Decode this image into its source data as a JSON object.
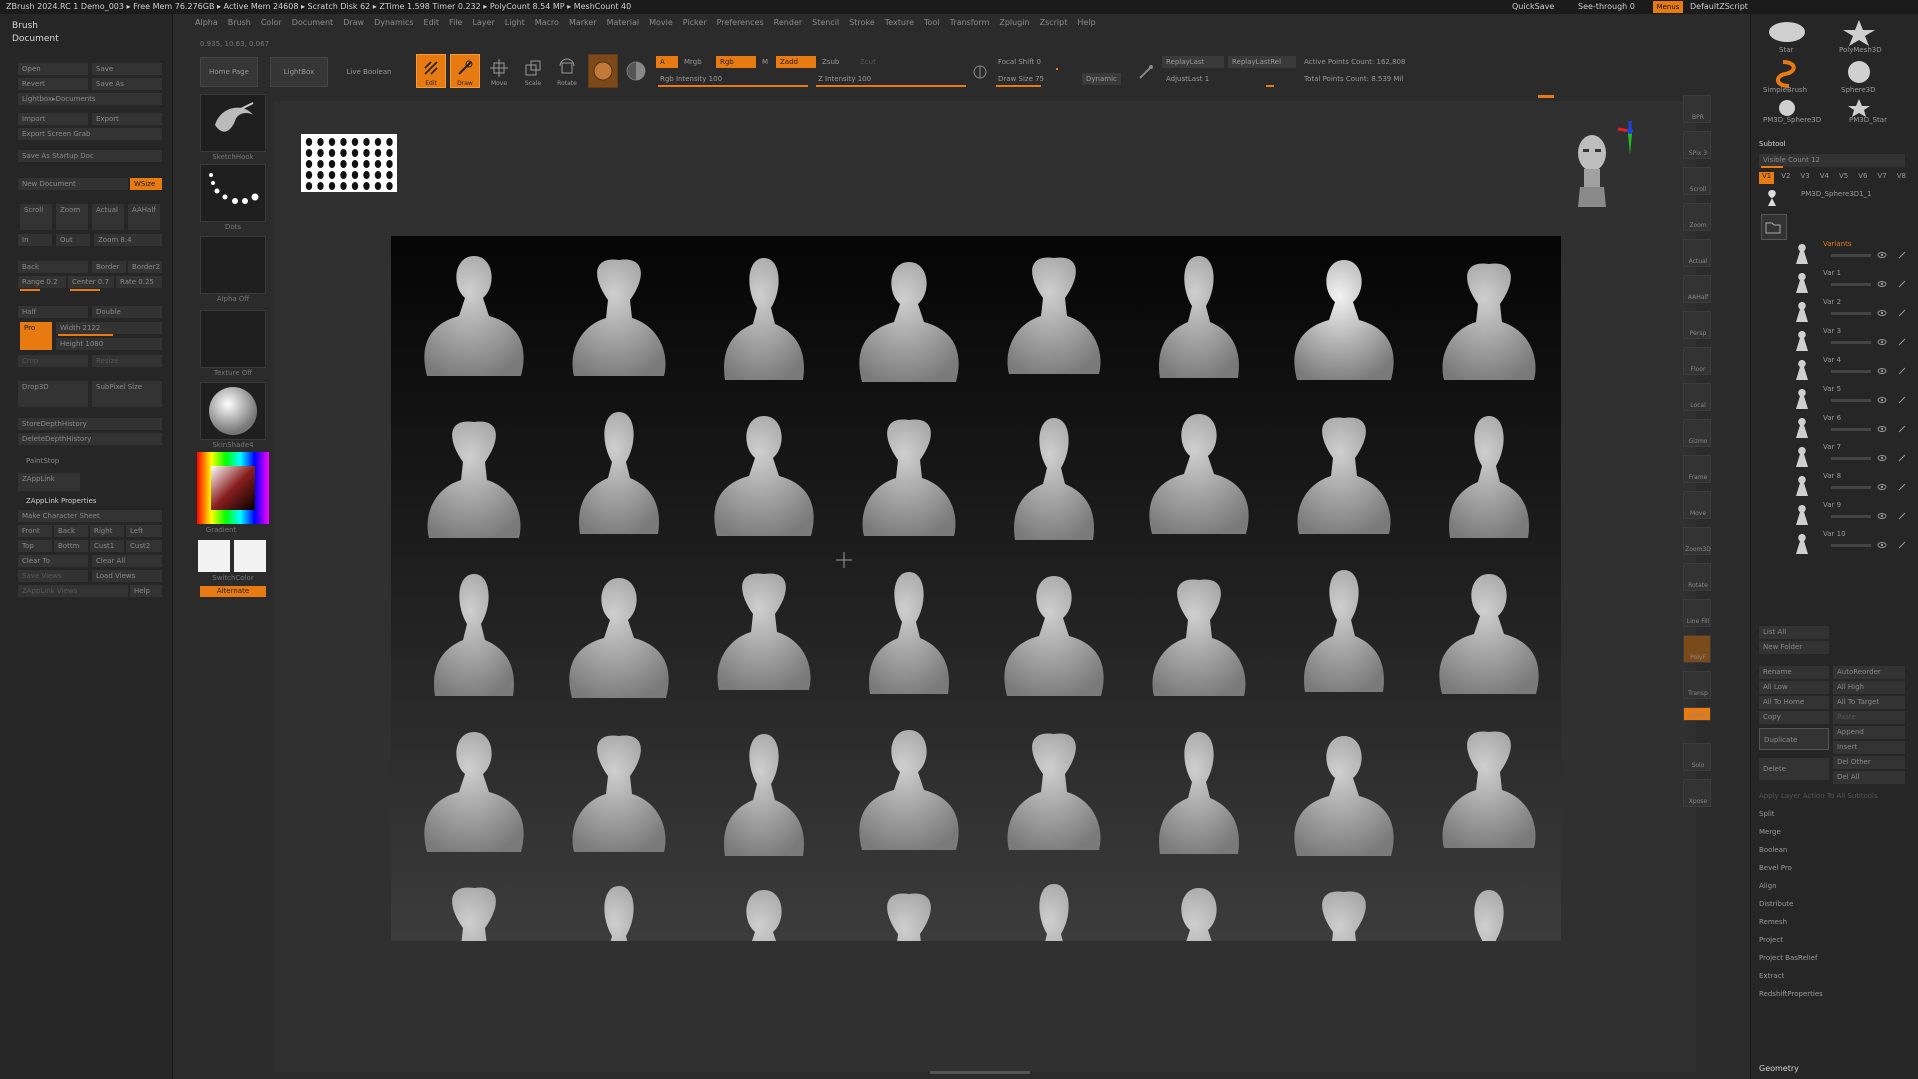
{
  "titlebar": {
    "title": "ZBrush 2024.RC 1   Demo_003   ▸ Free Mem 76.276GB ▸ Active Mem 24608 ▸ Scratch Disk 62 ▸ ZTime 1.598 Timer 0.232 ▸ PolyCount 8.54 MP ▸ MeshCount 40",
    "quicksave": "QuickSave",
    "seethrough": "See-through  0",
    "menus": "Menus",
    "defzscript": "DefaultZScript"
  },
  "menubar": [
    "Alpha",
    "Brush",
    "Color",
    "Document",
    "Draw",
    "Dynamics",
    "Edit",
    "File",
    "Layer",
    "Light",
    "Macro",
    "Marker",
    "Material",
    "Movie",
    "Picker",
    "Preferences",
    "Render",
    "Stencil",
    "Stroke",
    "Texture",
    "Tool",
    "Transform",
    "Zplugin",
    "Zscript",
    "Help"
  ],
  "coords": "0.935, 10.63, 0.067",
  "leftpanel": {
    "brush": "Brush",
    "document": "Document",
    "open": "Open",
    "save": "Save",
    "revert": "Revert",
    "save_as": "Save As",
    "lightbox_documents": "Lightbox▸Documents",
    "import": "Import",
    "export": "Export",
    "export_screen_grab": "Export Screen Grab",
    "save_as_startup": "Save As Startup Doc",
    "new_document": "New Document",
    "wsize": "WSize",
    "scroll": "Scroll",
    "zoom": "Zoom",
    "actual": "Actual",
    "aahalf": "AAHalf",
    "in": "In",
    "out": "Out",
    "zoom_val": "Zoom 8.4",
    "back": "Back",
    "border": "Border",
    "border2": "Border2",
    "range": "Range 0.2",
    "center": "Center 0.7",
    "rate": "Rate 0.25",
    "half": "Half",
    "double": "Double",
    "pro": "Pro",
    "width": "Width 2122",
    "height": "Height 1080",
    "crop": "Crop",
    "resize": "Resize",
    "drop3d": "Drop3D",
    "subpixel": "SubPixel Size",
    "store_depth": "StoreDepthHistory",
    "delete_depth": "DeleteDepthHistory",
    "paintstop": "PaintStop",
    "zapplink": "ZAppLink",
    "zapplink_props": "ZAppLink Properties",
    "make_char_sheet": "Make Character Sheet",
    "front": "Front",
    "back2": "Back",
    "right": "Right",
    "left": "Left",
    "top": "Top",
    "bottom": "Bottm",
    "cust1": "Cust1",
    "cust2": "Cust2",
    "clear_to": "Clear To",
    "clear_all": "Clear All",
    "save_views": "Save Views",
    "load_views": "Load Views",
    "zapplink_views": "ZAppLink Views",
    "help": "Help"
  },
  "toolcol": {
    "sketch_hook": "SketchHook",
    "dots": "Dots",
    "alpha_off": "Alpha Off",
    "texture_off": "Texture Off",
    "material": "SkinShade4",
    "gradient": "Gradient",
    "switch_color": "SwitchColor",
    "alternate": "Alternate"
  },
  "toolbar": {
    "home_page": "Home Page",
    "lightbox": "LightBox",
    "live_boolean": "Live Boolean",
    "edit": "Edit",
    "draw": "Draw",
    "move": "Move",
    "scale": "Scale",
    "rotate": "Rotate",
    "a": "A",
    "mrgb": "Mrgb",
    "rgb": "Rgb",
    "m": "M",
    "zadd": "Zadd",
    "zsub": "Zsub",
    "zcut": "Zcut",
    "rgb_intensity": "Rgb Intensity 100",
    "z_intensity": "Z Intensity 100",
    "focal_shift": "Focal Shift 0",
    "draw_size": "Draw Size 75",
    "dynamic": "Dynamic",
    "replay_last": "ReplayLast",
    "replay_last_rel": "ReplayLastRel",
    "active_points": "Active Points Count: 162,808",
    "total_points": "Total Points Count: 8.539 Mil",
    "adjust_last": "AdjustLast 1"
  },
  "rightpanel": {
    "star": "Star",
    "polymesh3d": "PolyMesh3D",
    "simple_brush": "SimpleBrush",
    "sphere3d": "Sphere3D",
    "pm3d_sphere3d": "PM3D_Sphere3D",
    "pm3d_star": "PM3D_Star",
    "subtool": "Subtool",
    "visible_count": "Visible Count 12",
    "v_tabs": [
      "V1",
      "V2",
      "V3",
      "V4",
      "V5",
      "V6",
      "V7",
      "V8"
    ],
    "pm3d_sphere3d_1": "PM3D_Sphere3D1_1",
    "variants": [
      "Variants",
      "Var 1",
      "Var 2",
      "Var 3",
      "Var 4",
      "Var 5",
      "Var 6",
      "Var 7",
      "Var 8",
      "Var 9",
      "Var 10"
    ],
    "list_all": "List All",
    "new_folder": "New Folder",
    "rename": "Rename",
    "auto_reorder": "AutoReorder",
    "all_low": "All Low",
    "all_high": "All High",
    "all_to_home": "All To Home",
    "all_to_target": "All To Target",
    "copy": "Copy",
    "paste": "Paste",
    "duplicate": "Duplicate",
    "append": "Append",
    "insert": "Insert",
    "delete": "Delete",
    "del_other": "Del Other",
    "del_all": "Del All",
    "apply_layer": "Apply Layer Action To All Subtools",
    "menu": [
      "Split",
      "Merge",
      "Boolean",
      "Bevel Pro",
      "Align",
      "Distribute",
      "Remesh",
      "Project",
      "Project BasRelief",
      "Extract",
      "RedshiftProperties"
    ],
    "geometry": "Geometry"
  },
  "shelf": {
    "bpr": "BPR",
    "spix": "SPix 3",
    "scroll": "Scroll",
    "zoom": "Zoom",
    "actual": "Actual",
    "aahalf": "AAHalf",
    "persp": "Persp",
    "floor": "Floor",
    "local": "Local",
    "gizmo": "Gizmo",
    "frame": "Frame",
    "move": "Move",
    "zoom3d": "Zoom3D",
    "rotate": "Rotate",
    "linefill": "Line Fill",
    "polyf": "PolyF",
    "transp": "Transp",
    "ghost": "Ghost",
    "solo": "Solo",
    "xpose": "Xpose"
  },
  "colors": {
    "accent": "#e87a12",
    "bg": "#2b2b2b",
    "panel": "#262626"
  }
}
